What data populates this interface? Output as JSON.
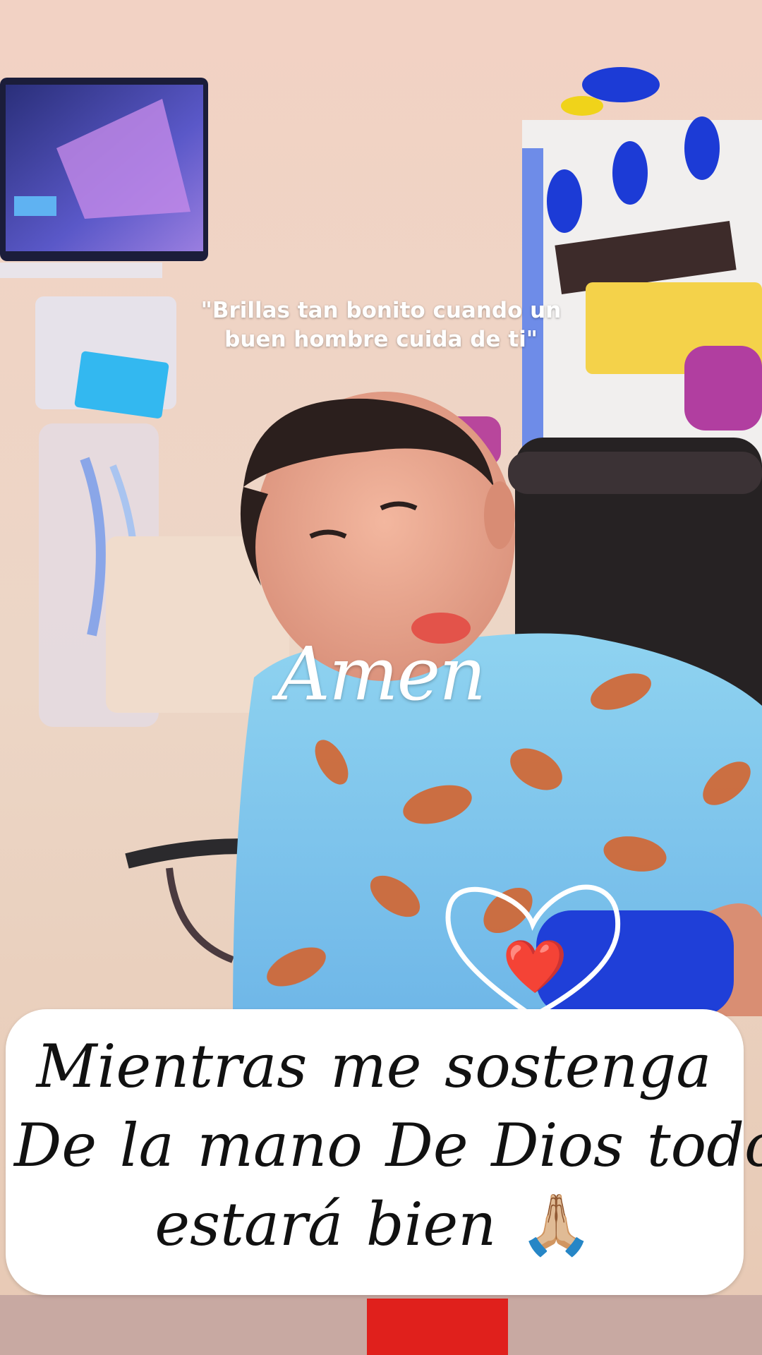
{
  "overlay": {
    "quote_line1": "\"Brillas tan bonito cuando un",
    "quote_line2": "buen hombre cuida de ti\"",
    "amen": "Amen",
    "heart_emoji": "❤️"
  },
  "caption": {
    "line1": "Mientras me sostenga",
    "line2": "De la mano De Dios todo",
    "line3": "estará bien",
    "emoji": "🙏🏼"
  },
  "icons": [
    "heart-outline-icon",
    "red-heart-emoji",
    "praying-hands-emoji"
  ],
  "colors": {
    "caption_background": "#ffffff",
    "caption_text": "#111111",
    "overlay_text": "#ffffff",
    "heart_red": "#e0101c"
  }
}
